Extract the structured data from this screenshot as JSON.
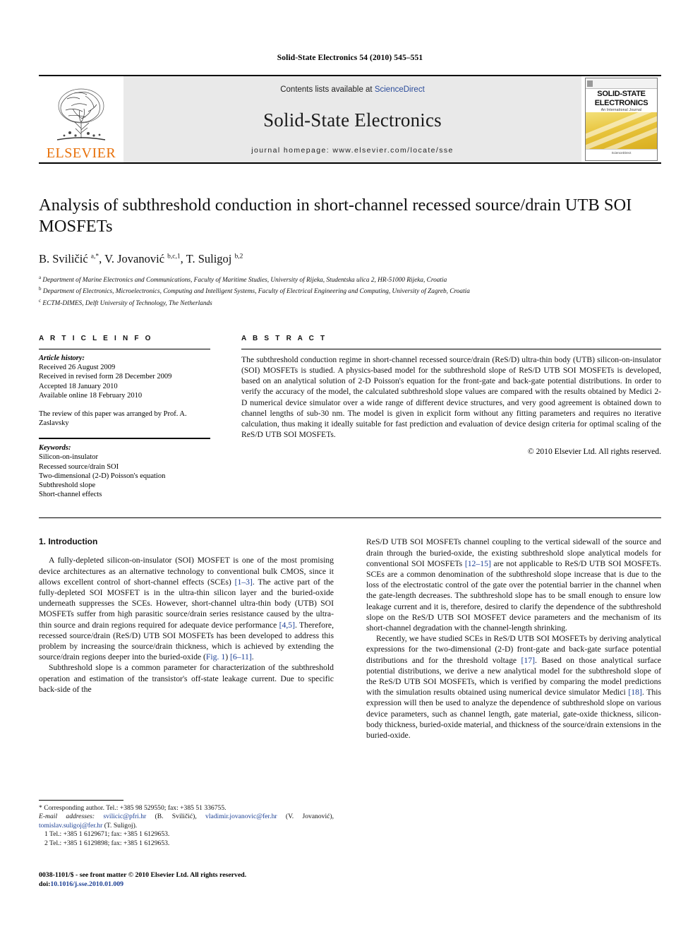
{
  "running_head": "Solid-State Electronics 54 (2010) 545–551",
  "masthead": {
    "publisher_name": "ELSEVIER",
    "contents_prefix": "Contents lists available at ",
    "contents_link": "ScienceDirect",
    "journal_title": "Solid-State Electronics",
    "homepage_line": "journal homepage: www.elsevier.com/locate/sse",
    "cover": {
      "title_line1": "SOLID-STATE",
      "title_line2": "ELECTRONICS",
      "subtitle": "An International Journal",
      "footer": "ScienceDirect"
    }
  },
  "article": {
    "title": "Analysis of subthreshold conduction in short-channel recessed source/drain UTB SOI MOSFETs",
    "authors": "B. Sviličić a,*, V. Jovanović b,c,1, T. Suligoj b,2",
    "affiliations": [
      "a Department of Marine Electronics and Communications, Faculty of Maritime Studies, University of Rijeka, Studentska ulica 2, HR-51000 Rijeka, Croatia",
      "b Department of Electronics, Microelectronics, Computing and Intelligent Systems, Faculty of Electrical Engineering and Computing, University of Zagreb, Croatia",
      "c ECTM-DIMES, Delft University of Technology, The Netherlands"
    ]
  },
  "info": {
    "heading": "A R T I C L E   I N F O",
    "history_label": "Article history:",
    "history": [
      "Received 26 August 2009",
      "Received in revised form 28 December 2009",
      "Accepted 18 January 2010",
      "Available online 18 February 2010"
    ],
    "review_note": "The review of this paper was arranged by Prof. A. Zaslavsky",
    "keywords_label": "Keywords:",
    "keywords": [
      "Silicon-on-insulator",
      "Recessed source/drain SOI",
      "Two-dimensional (2-D) Poisson's equation",
      "Subthreshold slope",
      "Short-channel effects"
    ]
  },
  "abstract": {
    "heading": "A B S T R A C T",
    "text": "The subthreshold conduction regime in short-channel recessed source/drain (ReS/D) ultra-thin body (UTB) silicon-on-insulator (SOI) MOSFETs is studied. A physics-based model for the subthreshold slope of ReS/D UTB SOI MOSFETs is developed, based on an analytical solution of 2-D Poisson's equation for the front-gate and back-gate potential distributions. In order to verify the accuracy of the model, the calculated subthreshold slope values are compared with the results obtained by Medici 2-D numerical device simulator over a wide range of different device structures, and very good agreement is obtained down to channel lengths of sub-30 nm. The model is given in explicit form without any fitting parameters and requires no iterative calculation, thus making it ideally suitable for fast prediction and evaluation of device design criteria for optimal scaling of the ReS/D UTB SOI MOSFETs.",
    "copyright": "© 2010 Elsevier Ltd. All rights reserved."
  },
  "body": {
    "section_title": "1. Introduction",
    "left_paragraphs": [
      "A fully-depleted silicon-on-insulator (SOI) MOSFET is one of the most promising device architectures as an alternative technology to conventional bulk CMOS, since it allows excellent control of short-channel effects (SCEs) [1–3]. The active part of the fully-depleted SOI MOSFET is in the ultra-thin silicon layer and the buried-oxide underneath suppresses the SCEs. However, short-channel ultra-thin body (UTB) SOI MOSFETs suffer from high parasitic source/drain series resistance caused by the ultra-thin source and drain regions required for adequate device performance [4,5]. Therefore, recessed source/drain (ReS/D) UTB SOI MOSFETs has been developed to address this problem by increasing the source/drain thickness, which is achieved by extending the source/drain regions deeper into the buried-oxide (Fig. 1) [6–11].",
      "Subthreshold slope is a common parameter for characterization of the subthreshold operation and estimation of the transistor's off-state leakage current. Due to specific back-side of the"
    ],
    "right_paragraphs": [
      "ReS/D UTB SOI MOSFETs channel coupling to the vertical sidewall of the source and drain through the buried-oxide, the existing subthreshold slope analytical models for conventional SOI MOSFETs [12–15] are not applicable to ReS/D UTB SOI MOSFETs. SCEs are a common denomination of the subthreshold slope increase that is due to the loss of the electrostatic control of the gate over the potential barrier in the channel when the gate-length decreases. The subthreshold slope has to be small enough to ensure low leakage current and it is, therefore, desired to clarify the dependence of the subthreshold slope on the ReS/D UTB SOI MOSFET device parameters and the mechanism of its short-channel degradation with the channel-length shrinking.",
      "Recently, we have studied SCEs in ReS/D UTB SOI MOSFETs by deriving analytical expressions for the two-dimensional (2-D) front-gate and back-gate surface potential distributions and for the threshold voltage [17]. Based on those analytical surface potential distributions, we derive a new analytical model for the subthreshold slope of the ReS/D UTB SOI MOSFETs, which is verified by comparing the model predictions with the simulation results obtained using numerical device simulator Medici [18]. This expression will then be used to analyze the dependence of subthreshold slope on various device parameters, such as channel length, gate material, gate-oxide thickness, silicon-body thickness, buried-oxide material, and thickness of the source/drain extensions in the buried-oxide."
    ]
  },
  "footnotes": {
    "corresponding": "* Corresponding author. Tel.: +385 98 529550; fax: +385 51 336755.",
    "email_label": "E-mail addresses:",
    "email_1": "svilicic@pfri.hr",
    "email_1_name": "(B. Sviličić),",
    "email_2": "vladimir.jovanovic@fer.hr",
    "email_2_name": "(V. Jovanović),",
    "email_3": "tomislav.suligoj@fer.hr",
    "email_3_name": "(T. Suligoj).",
    "note_1": "1 Tel.: +385 1 6129671; fax: +385 1 6129653.",
    "note_2": "2 Tel.: +385 1 6129898; fax: +385 1 6129653."
  },
  "imprint": {
    "line1": "0038-1101/$ - see front matter © 2010 Elsevier Ltd. All rights reserved.",
    "doi_label": "doi:",
    "doi_value": "10.1016/j.sse.2010.01.009"
  },
  "colors": {
    "link": "#1c3f94",
    "elsevier_orange": "#E8710A",
    "masthead_bg": "#e9e9e9"
  }
}
